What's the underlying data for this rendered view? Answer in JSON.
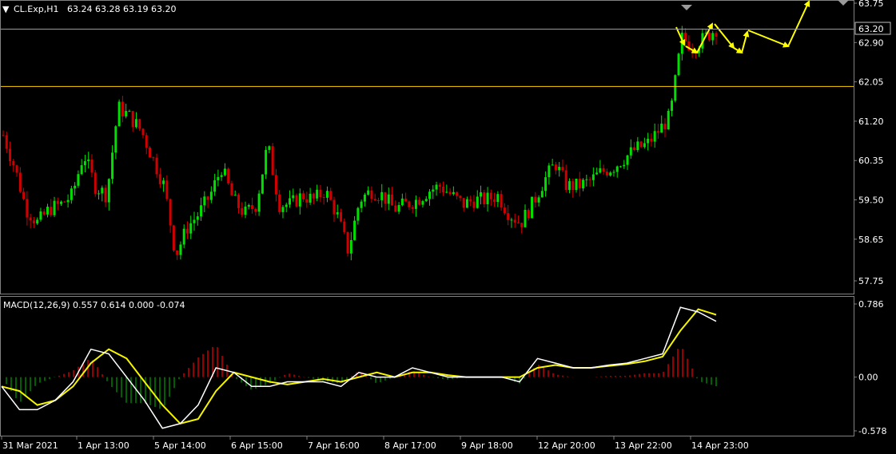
{
  "window": {
    "symbol_caption": "CL.Exp,H1",
    "ohlc_caption": "63.24 63.28 63.19 63.20",
    "collapse_glyph": "▼"
  },
  "colors": {
    "background": "#000000",
    "bull": "#00e000",
    "bear": "#d00000",
    "grid_frame": "#808080",
    "level_line": "#ffd000",
    "arrow": "#ffff00",
    "macd_main": "#ffffff",
    "macd_signal": "#f5f500",
    "hist_pos": "#c80000",
    "hist_neg": "#008000",
    "price_tag_bg": "#000000"
  },
  "price_axis": {
    "ticks": [
      "63.75",
      "62.90",
      "62.05",
      "61.20",
      "60.35",
      "59.50",
      "58.65",
      "57.75"
    ],
    "current_price": "63.20",
    "range": [
      57.55,
      63.85
    ]
  },
  "horizontal_level": {
    "price": 61.95
  },
  "time_axis": {
    "labels": [
      "31 Mar 2021",
      "1 Apr 13:00",
      "5 Apr 14:00",
      "6 Apr 15:00",
      "7 Apr 16:00",
      "8 Apr 17:00",
      "9 Apr 18:00",
      "12 Apr 20:00",
      "13 Apr 22:00",
      "14 Apr 23:00"
    ]
  },
  "indicator": {
    "caption": "MACD(12,26,9) 0.557 0.614 0.000 -0.074",
    "ticks": [
      "0.786",
      "0.00",
      "-0.578"
    ],
    "range": [
      -0.6,
      0.82
    ]
  },
  "chart_data": {
    "type": "candlestick",
    "symbol": "CL.Exp",
    "timeframe": "H1",
    "last_bar": {
      "open": 63.24,
      "high": 63.28,
      "low": 63.19,
      "close": 63.2
    },
    "price_series_approx": [
      60.9,
      60.2,
      59.3,
      59.0,
      59.3,
      59.4,
      59.6,
      60.5,
      59.8,
      59.6,
      61.5,
      61.3,
      61.0,
      60.4,
      59.8,
      58.3,
      58.9,
      59.2,
      59.6,
      60.2,
      59.5,
      59.2,
      59.4,
      60.7,
      59.4,
      59.4,
      59.6,
      59.5,
      59.7,
      59.2,
      58.4,
      59.5,
      59.7,
      59.6,
      59.3,
      59.4,
      59.5,
      59.7,
      59.8,
      59.6,
      59.4,
      59.5,
      59.5,
      59.6,
      59.2,
      59.0,
      59.4,
      59.9,
      60.3,
      59.8,
      59.8,
      59.9,
      60.1,
      60.2,
      60.4,
      60.6,
      60.7,
      61.0,
      61.3,
      63.0,
      62.8,
      63.0,
      63.2
    ],
    "macd_main_approx": [
      -0.1,
      -0.35,
      -0.35,
      -0.25,
      -0.05,
      0.3,
      0.25,
      0.0,
      -0.25,
      -0.55,
      -0.5,
      -0.3,
      0.1,
      0.05,
      -0.1,
      -0.1,
      -0.05,
      -0.05,
      -0.05,
      -0.1,
      0.05,
      0.0,
      0.0,
      0.1,
      0.05,
      0.0,
      0.0,
      0.0,
      0.0,
      -0.05,
      0.2,
      0.15,
      0.1,
      0.1,
      0.13,
      0.15,
      0.2,
      0.25,
      0.75,
      0.7,
      0.6
    ],
    "macd_signal_approx": [
      -0.1,
      -0.15,
      -0.3,
      -0.25,
      -0.1,
      0.15,
      0.3,
      0.2,
      -0.05,
      -0.3,
      -0.5,
      -0.45,
      -0.15,
      0.05,
      0.0,
      -0.05,
      -0.08,
      -0.05,
      -0.02,
      -0.05,
      0.0,
      0.05,
      0.0,
      0.05,
      0.05,
      0.02,
      0.0,
      0.0,
      0.0,
      0.0,
      0.1,
      0.13,
      0.1,
      0.1,
      0.12,
      0.14,
      0.17,
      0.22,
      0.5,
      0.73,
      0.67
    ],
    "projection_arrows": true
  }
}
